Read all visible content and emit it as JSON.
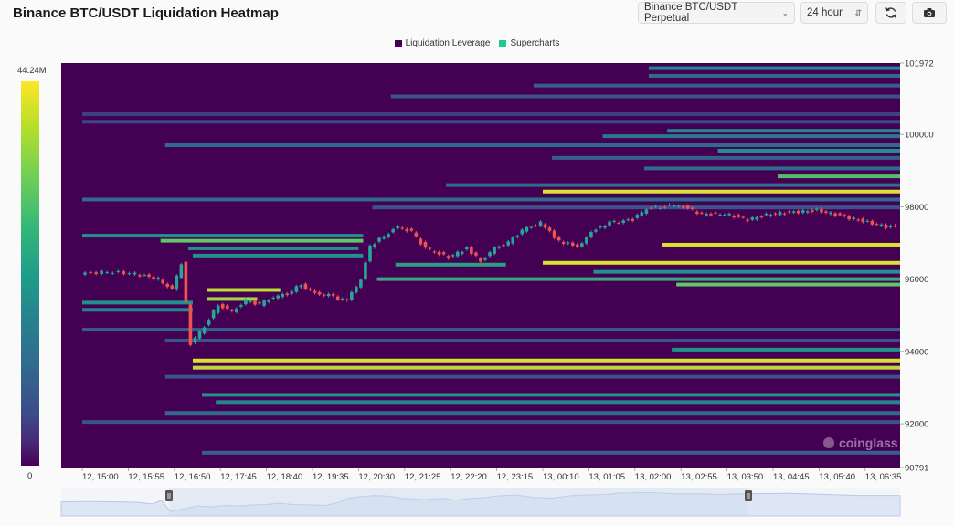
{
  "header": {
    "title": "Binance BTC/USDT Liquidation Heatmap",
    "market_select": "Binance BTC/USDT Perpetual",
    "period_select": "24 hour"
  },
  "legend": [
    {
      "label": "Liquidation Leverage",
      "color": "#440154"
    },
    {
      "label": "Supercharts",
      "color": "#21c98f"
    }
  ],
  "colorbar": {
    "max_label": "44.24M",
    "min_label": "0"
  },
  "watermark": "coinglass",
  "colors": {
    "background": "#440154",
    "candle_up": "#26a69a",
    "candle_down": "#ef5350",
    "navigator_fill": "#dde6f5"
  },
  "chart_data": {
    "type": "heatmap",
    "title": "",
    "x_ticks": [
      "12, 15:00",
      "12, 15:55",
      "12, 16:50",
      "12, 17:45",
      "12, 18:40",
      "12, 19:35",
      "12, 20:30",
      "12, 21:25",
      "12, 22:20",
      "12, 23:15",
      "13, 00:10",
      "13, 01:05",
      "13, 02:00",
      "13, 02:55",
      "13, 03:50",
      "13, 04:45",
      "13, 05:40",
      "13, 06:35"
    ],
    "x_range_index": [
      0,
      18.45
    ],
    "y_ticks": [
      101972,
      100000,
      98000,
      96000,
      94000,
      92000,
      90791
    ],
    "y_range": [
      90791,
      101972
    ],
    "colorbar_range": [
      0,
      44.24
    ],
    "colorbar_unit": "M",
    "liquidation_bands": [
      {
        "price": 101830,
        "start": 12.3,
        "end": 18.45,
        "level": 0.45
      },
      {
        "price": 101620,
        "start": 12.3,
        "end": 18.45,
        "level": 0.35
      },
      {
        "price": 101350,
        "start": 9.8,
        "end": 18.45,
        "level": 0.3
      },
      {
        "price": 101050,
        "start": 6.7,
        "end": 18.45,
        "level": 0.25
      },
      {
        "price": 100560,
        "start": 0,
        "end": 18.45,
        "level": 0.2
      },
      {
        "price": 100350,
        "start": 0,
        "end": 18.45,
        "level": 0.22
      },
      {
        "price": 100100,
        "start": 12.7,
        "end": 18.45,
        "level": 0.45
      },
      {
        "price": 99950,
        "start": 11.3,
        "end": 18.45,
        "level": 0.4
      },
      {
        "price": 99700,
        "start": 1.8,
        "end": 18.45,
        "level": 0.35
      },
      {
        "price": 99550,
        "start": 13.8,
        "end": 18.45,
        "level": 0.5
      },
      {
        "price": 99350,
        "start": 10.2,
        "end": 18.45,
        "level": 0.3
      },
      {
        "price": 99060,
        "start": 12.2,
        "end": 18.45,
        "level": 0.35
      },
      {
        "price": 98840,
        "start": 15.1,
        "end": 18.45,
        "level": 0.7
      },
      {
        "price": 98600,
        "start": 7.9,
        "end": 18.45,
        "level": 0.35
      },
      {
        "price": 98420,
        "start": 10,
        "end": 18.45,
        "level": 0.95
      },
      {
        "price": 98200,
        "start": 0,
        "end": 18.45,
        "level": 0.35
      },
      {
        "price": 97980,
        "start": 6.3,
        "end": 18.45,
        "level": 0.25
      },
      {
        "price": 97200,
        "start": 0,
        "end": 6.1,
        "level": 0.5
      },
      {
        "price": 97060,
        "start": 1.7,
        "end": 6.1,
        "level": 0.75
      },
      {
        "price": 96950,
        "start": 12.6,
        "end": 18.45,
        "level": 0.95
      },
      {
        "price": 96850,
        "start": 2.3,
        "end": 6.0,
        "level": 0.5
      },
      {
        "price": 96650,
        "start": 2.4,
        "end": 6.1,
        "level": 0.5
      },
      {
        "price": 96450,
        "start": 10,
        "end": 18.45,
        "level": 0.95
      },
      {
        "price": 96400,
        "start": 6.8,
        "end": 9.2,
        "level": 0.55
      },
      {
        "price": 96200,
        "start": 11.1,
        "end": 18.45,
        "level": 0.5
      },
      {
        "price": 96000,
        "start": 6.4,
        "end": 18.45,
        "level": 0.6
      },
      {
        "price": 95850,
        "start": 12.9,
        "end": 18.45,
        "level": 0.75
      },
      {
        "price": 95700,
        "start": 2.7,
        "end": 4.3,
        "level": 0.9
      },
      {
        "price": 95450,
        "start": 2.7,
        "end": 3.8,
        "level": 0.85
      },
      {
        "price": 95350,
        "start": 0,
        "end": 2.4,
        "level": 0.5
      },
      {
        "price": 95150,
        "start": 0,
        "end": 2.4,
        "level": 0.45
      },
      {
        "price": 94600,
        "start": 0,
        "end": 18.45,
        "level": 0.3
      },
      {
        "price": 94300,
        "start": 1.8,
        "end": 18.45,
        "level": 0.25
      },
      {
        "price": 94050,
        "start": 12.8,
        "end": 18.45,
        "level": 0.5
      },
      {
        "price": 93750,
        "start": 2.4,
        "end": 18.45,
        "level": 0.95
      },
      {
        "price": 93550,
        "start": 2.4,
        "end": 18.45,
        "level": 0.9
      },
      {
        "price": 93300,
        "start": 1.8,
        "end": 18.45,
        "level": 0.25
      },
      {
        "price": 92800,
        "start": 2.6,
        "end": 18.45,
        "level": 0.5
      },
      {
        "price": 92600,
        "start": 2.9,
        "end": 18.45,
        "level": 0.45
      },
      {
        "price": 92300,
        "start": 1.8,
        "end": 18.45,
        "level": 0.35
      },
      {
        "price": 92050,
        "start": 0,
        "end": 18.45,
        "level": 0.25
      },
      {
        "price": 91200,
        "start": 2.6,
        "end": 18.45,
        "level": 0.3
      }
    ],
    "price_series": [
      [
        0.0,
        96150
      ],
      [
        0.6,
        96200
      ],
      [
        1.2,
        96150
      ],
      [
        1.7,
        96000
      ],
      [
        2.0,
        95700
      ],
      [
        2.2,
        96450
      ],
      [
        2.4,
        94200
      ],
      [
        2.7,
        94700
      ],
      [
        3.0,
        95300
      ],
      [
        3.3,
        95100
      ],
      [
        3.6,
        95400
      ],
      [
        3.9,
        95300
      ],
      [
        4.2,
        95500
      ],
      [
        4.5,
        95600
      ],
      [
        4.8,
        95850
      ],
      [
        5.1,
        95600
      ],
      [
        5.4,
        95550
      ],
      [
        5.8,
        95400
      ],
      [
        6.1,
        96000
      ],
      [
        6.3,
        96900
      ],
      [
        6.6,
        97200
      ],
      [
        6.9,
        97450
      ],
      [
        7.2,
        97300
      ],
      [
        7.5,
        96850
      ],
      [
        8.0,
        96600
      ],
      [
        8.4,
        96850
      ],
      [
        8.7,
        96500
      ],
      [
        9.0,
        96850
      ],
      [
        9.3,
        97000
      ],
      [
        9.6,
        97350
      ],
      [
        10.0,
        97550
      ],
      [
        10.4,
        97050
      ],
      [
        10.8,
        96900
      ],
      [
        11.2,
        97400
      ],
      [
        11.5,
        97550
      ],
      [
        12.0,
        97650
      ],
      [
        12.3,
        97950
      ],
      [
        12.6,
        98000
      ],
      [
        13.0,
        98050
      ],
      [
        13.5,
        97800
      ],
      [
        14.0,
        97800
      ],
      [
        14.5,
        97650
      ],
      [
        15.0,
        97800
      ],
      [
        15.5,
        97850
      ],
      [
        16.0,
        97900
      ],
      [
        16.5,
        97750
      ],
      [
        17.0,
        97600
      ],
      [
        17.5,
        97450
      ],
      [
        18.0,
        97450
      ],
      [
        18.45,
        97450
      ]
    ]
  }
}
